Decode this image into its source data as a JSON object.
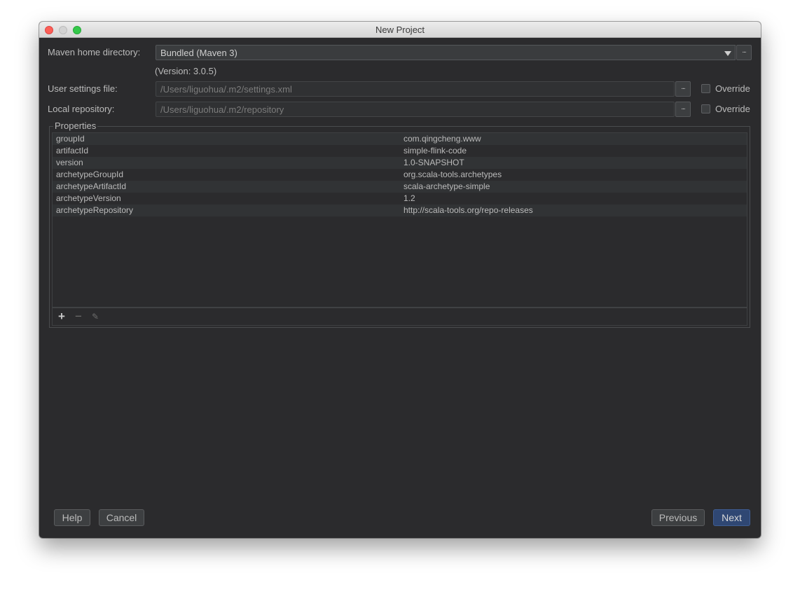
{
  "window": {
    "title": "New Project"
  },
  "maven_home": {
    "label": "Maven home directory:",
    "value": "Bundled (Maven 3)",
    "version": "(Version: 3.0.5)",
    "browse_label": "..."
  },
  "user_settings": {
    "label": "User settings file:",
    "value": "/Users/liguohua/.m2/settings.xml",
    "browse_label": "...",
    "override_label": "Override",
    "override_checked": false
  },
  "local_repo": {
    "label": "Local repository:",
    "value": "/Users/liguohua/.m2/repository",
    "browse_label": "...",
    "override_label": "Override",
    "override_checked": false
  },
  "properties": {
    "title": "Properties",
    "rows": [
      {
        "key": "groupId",
        "value": "com.qingcheng.www"
      },
      {
        "key": "artifactId",
        "value": "simple-flink-code"
      },
      {
        "key": "version",
        "value": "1.0-SNAPSHOT"
      },
      {
        "key": "archetypeGroupId",
        "value": "org.scala-tools.archetypes"
      },
      {
        "key": "archetypeArtifactId",
        "value": "scala-archetype-simple"
      },
      {
        "key": "archetypeVersion",
        "value": "1.2"
      },
      {
        "key": "archetypeRepository",
        "value": "http://scala-tools.org/repo-releases"
      }
    ],
    "toolbar": {
      "add_icon": "+",
      "remove_icon": "−",
      "edit_icon": "✎"
    }
  },
  "buttons": {
    "help": "Help",
    "cancel": "Cancel",
    "previous": "Previous",
    "next": "Next"
  },
  "colors": {
    "background": "#2b2b2d",
    "primary_button": "#2f4773",
    "close_light": "#fc5f57",
    "zoom_light": "#34c84a"
  }
}
